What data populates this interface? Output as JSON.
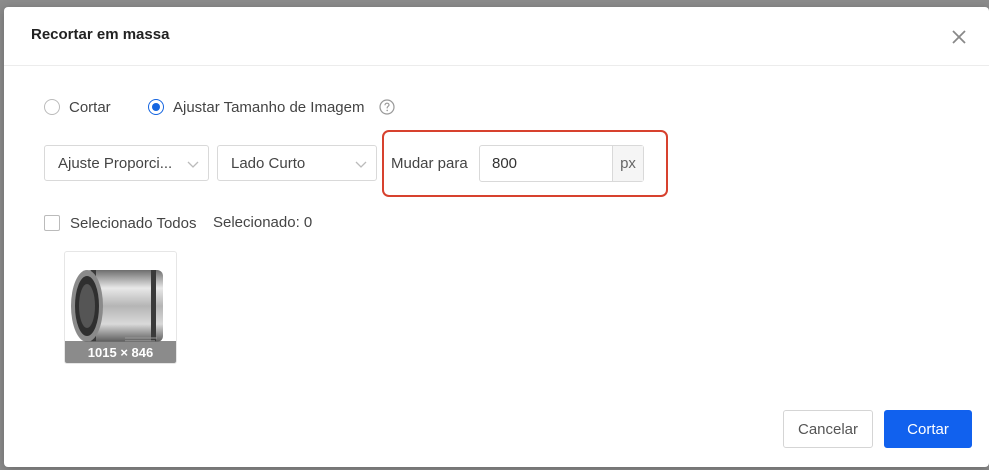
{
  "dialog": {
    "title": "Recortar em massa",
    "close_icon": "close-icon"
  },
  "mode": {
    "options": [
      {
        "label": "Cortar",
        "selected": false
      },
      {
        "label": "Ajustar Tamanho de Imagem",
        "selected": true
      }
    ],
    "help_icon": "question-circle-icon"
  },
  "resize": {
    "method_select": "Ajuste Proporci...",
    "side_select": "Lado Curto",
    "change_to_label": "Mudar para",
    "value": "800",
    "unit": "px",
    "highlight_color": "#d7412e"
  },
  "selection": {
    "select_all_label": "Selecionado Todos",
    "select_all_checked": false,
    "count_label": "Selecionado: 0"
  },
  "images": [
    {
      "dimensions": "1015 × 846"
    }
  ],
  "footer": {
    "cancel_label": "Cancelar",
    "confirm_label": "Cortar"
  },
  "colors": {
    "primary": "#1161ee",
    "radio_checked": "#1565e0"
  }
}
